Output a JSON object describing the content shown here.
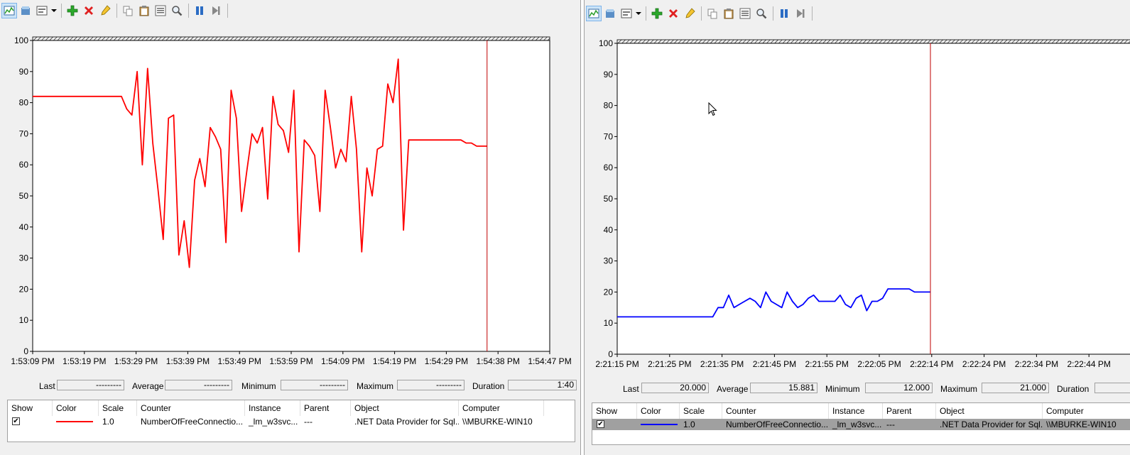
{
  "toolbar_icons": [
    "view-graph-icon",
    "view-histogram-icon",
    "change-graph-type-icon",
    "dropdown-caret-icon",
    "add-counter-icon",
    "delete-counter-icon",
    "highlight-icon",
    "copy-properties-icon",
    "paste-counter-list-icon",
    "properties-icon",
    "zoom-icon",
    "freeze-display-icon",
    "update-data-icon"
  ],
  "colors": {
    "left_series": "#ff0000",
    "right_series": "#0000ff",
    "time_bar": "#c00000",
    "selected_row": "#a0a0a0"
  },
  "left": {
    "stats": {
      "last_label": "Last",
      "last_value": "---------",
      "average_label": "Average",
      "average_value": "---------",
      "minimum_label": "Minimum",
      "minimum_value": "---------",
      "maximum_label": "Maximum",
      "maximum_value": "---------",
      "duration_label": "Duration",
      "duration_value": "1:40"
    },
    "legend": {
      "headers": [
        "Show",
        "Color",
        "Scale",
        "Counter",
        "Instance",
        "Parent",
        "Object",
        "Computer"
      ],
      "row": {
        "show": "✔",
        "scale": "1.0",
        "counter": "NumberOfFreeConnectio...",
        "instance": "_lm_w3svc...",
        "parent": "---",
        "object": ".NET Data Provider for Sql...",
        "computer": "\\\\MBURKE-WIN10"
      }
    }
  },
  "right": {
    "stats": {
      "last_label": "Last",
      "last_value": "20.000",
      "average_label": "Average",
      "average_value": "15.881",
      "minimum_label": "Minimum",
      "minimum_value": "12.000",
      "maximum_label": "Maximum",
      "maximum_value": "21.000",
      "duration_label": "Duration"
    },
    "legend": {
      "headers": [
        "Show",
        "Color",
        "Scale",
        "Counter",
        "Instance",
        "Parent",
        "Object",
        "Computer"
      ],
      "row": {
        "show": "✔",
        "scale": "1.0",
        "counter": "NumberOfFreeConnectio...",
        "instance": "_lm_w3svc...",
        "parent": "---",
        "object": ".NET Data Provider for Sql...",
        "computer": "\\\\MBURKE-WIN10"
      }
    }
  },
  "chart_data": [
    {
      "type": "line",
      "ylim": [
        0,
        100
      ],
      "yticks": [
        0,
        10,
        20,
        30,
        40,
        50,
        60,
        70,
        80,
        90,
        100
      ],
      "xticks": [
        "1:53:09 PM",
        "1:53:19 PM",
        "1:53:29 PM",
        "1:53:39 PM",
        "1:53:49 PM",
        "1:53:59 PM",
        "1:54:09 PM",
        "1:54:19 PM",
        "1:54:29 PM",
        "1:54:38 PM",
        "1:54:47 PM"
      ],
      "sample_count": 100,
      "current_sample": 87,
      "series": [
        {
          "color": "#ff0000",
          "values": [
            82,
            82,
            82,
            82,
            82,
            82,
            82,
            82,
            82,
            82,
            82,
            82,
            82,
            82,
            82,
            82,
            82,
            82,
            78,
            76,
            90,
            60,
            91,
            67,
            52,
            36,
            75,
            76,
            31,
            42,
            27,
            55,
            62,
            53,
            72,
            69,
            65,
            35,
            84,
            75,
            45,
            58,
            70,
            67,
            72,
            49,
            82,
            73,
            71,
            64,
            84,
            32,
            68,
            66,
            63,
            45,
            84,
            72,
            59,
            65,
            61,
            82,
            65,
            32,
            59,
            50,
            65,
            66,
            86,
            80,
            94,
            39,
            68,
            68,
            68,
            68,
            68,
            68,
            68,
            68,
            68,
            68,
            68,
            67,
            67,
            66,
            66,
            66
          ]
        }
      ]
    },
    {
      "type": "line",
      "ylim": [
        0,
        100
      ],
      "yticks": [
        0,
        10,
        20,
        30,
        40,
        50,
        60,
        70,
        80,
        90,
        100
      ],
      "xticks": [
        "2:21:15 PM",
        "2:21:25 PM",
        "2:21:35 PM",
        "2:21:45 PM",
        "2:21:55 PM",
        "2:22:05 PM",
        "2:22:14 PM",
        "2:22:24 PM",
        "2:22:34 PM",
        "2:22:44 PM"
      ],
      "sample_count": 100,
      "current_sample": 59,
      "series": [
        {
          "color": "#0000ff",
          "values": [
            12,
            12,
            12,
            12,
            12,
            12,
            12,
            12,
            12,
            12,
            12,
            12,
            12,
            12,
            12,
            12,
            12,
            12,
            12,
            15,
            15,
            19,
            15,
            16,
            17,
            18,
            17,
            15,
            20,
            17,
            16,
            15,
            20,
            17,
            15,
            16,
            18,
            19,
            17,
            17,
            17,
            17,
            19,
            16,
            15,
            18,
            19,
            14,
            17,
            17,
            18,
            21,
            21,
            21,
            21,
            21,
            20,
            20,
            20,
            20
          ]
        }
      ]
    }
  ]
}
